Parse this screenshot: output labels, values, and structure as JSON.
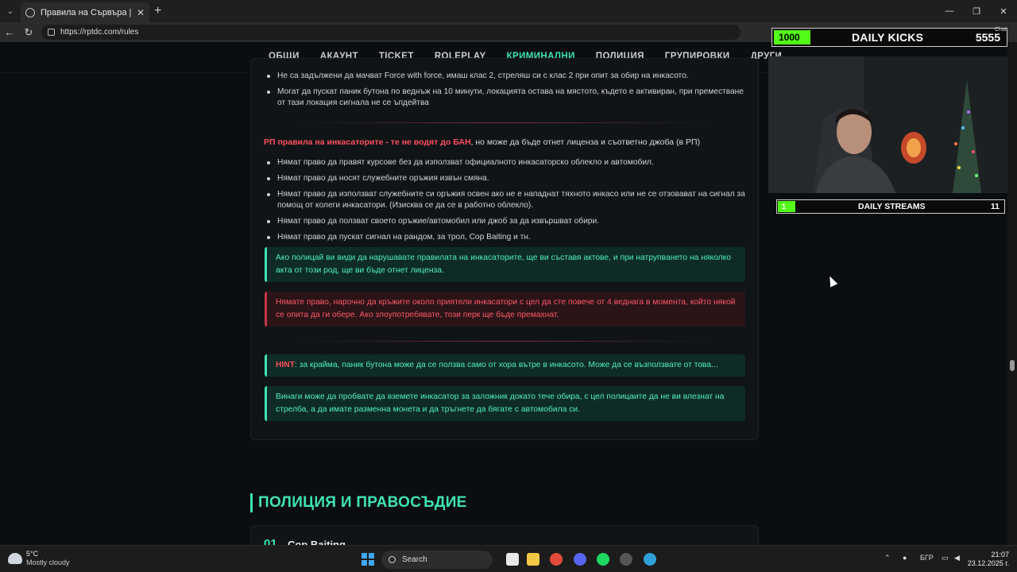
{
  "browser": {
    "tab_title": "Правила на Сървъра | TDC Rolep",
    "url": "https://rptdc.com/rules"
  },
  "site_nav": [
    "ОБЩИ",
    "АКАУНТ",
    "TICKET",
    "ROLEPLAY",
    "КРИМИНАЛНИ",
    "ПОЛИЦИЯ",
    "ГРУПИРОВКИ",
    "ДРУГИ"
  ],
  "site_nav_active": "КРИМИНАЛНИ",
  "top_bullets": [
    "Не са задължени да мачват Force with force, имаш клас 2, стреляш си с клас 2 при опит за обир на инкасото.",
    "Могат да пускат паник бутона по веднъж на 10 минути, локацията остава на мястото, където е активиран, при преместване от тази локация сигнала не се ъпдейтва"
  ],
  "section": {
    "title_red": "РП правила на инкасаторите - те не водят до БАН",
    "title_rest": ", но може да бъде отнет лиценза и съответно джоба (в РП)",
    "bullets": [
      "Нямат право да правят курсове без да използват официалното инкасаторско облекло и автомобил.",
      "Нямат право да носят служебните оръжия извън смяна.",
      "Нямат право да използват служебните си оръжия освен ако не е нападнат тяхното инкасо или не се отзовават на сигнал за помощ от колеги инкасатори. (Изисква се да се в работно облекло).",
      "Нямат право да ползват своето оръжие/автомобил или джоб за да извършват обири.",
      "Нямат право да пускат сигнал на рандом, за трол, Cop Baiting и тн."
    ]
  },
  "alerts": {
    "green1": "Ако полицай ви види да нарушавате правилата на инкасаторите, ще ви съставя актове, и при натрупването на няколко акта от този род, ще ви бъде отнет лиценза.",
    "red1": "Нямате право, нарочно да кръжите около приятели инкасатори с цел да сте повече от 4 веднага в момента, който някой се опита да ги обере. Ако злоупотребявате, този перк ще бъде премахнат.",
    "hint_label": "HINT",
    "hint_text": ": за крайма, паник бутона може да се ползва само от хора вътре в инкасото. Може да се възползвате от това...",
    "green2": "Винаги може да пробвате да вземете инкасатор за заложник докато тече обира, с цел полицаите да не ви влезнат на стрелба, а да имате разменна монета и да тръгнете да бягате с автомобила си."
  },
  "next_section": {
    "heading": "ПОЛИЦИЯ И ПРАВОСЪДИЕ",
    "first_num": "01",
    "first_title": "Cop Baiting"
  },
  "overlay": {
    "kicks_count": "1000",
    "kicks_label": "DAILY KICKS",
    "kicks_goal": "5555",
    "chat": "Chat",
    "streams_count": "1",
    "streams_label": "DAILY STREAMS",
    "streams_goal": "11"
  },
  "taskbar": {
    "temp": "5°C",
    "weather": "Mostly cloudy",
    "search": "Search",
    "lang": "БГР",
    "time": "21:07",
    "date": "23.12.2025 г."
  }
}
